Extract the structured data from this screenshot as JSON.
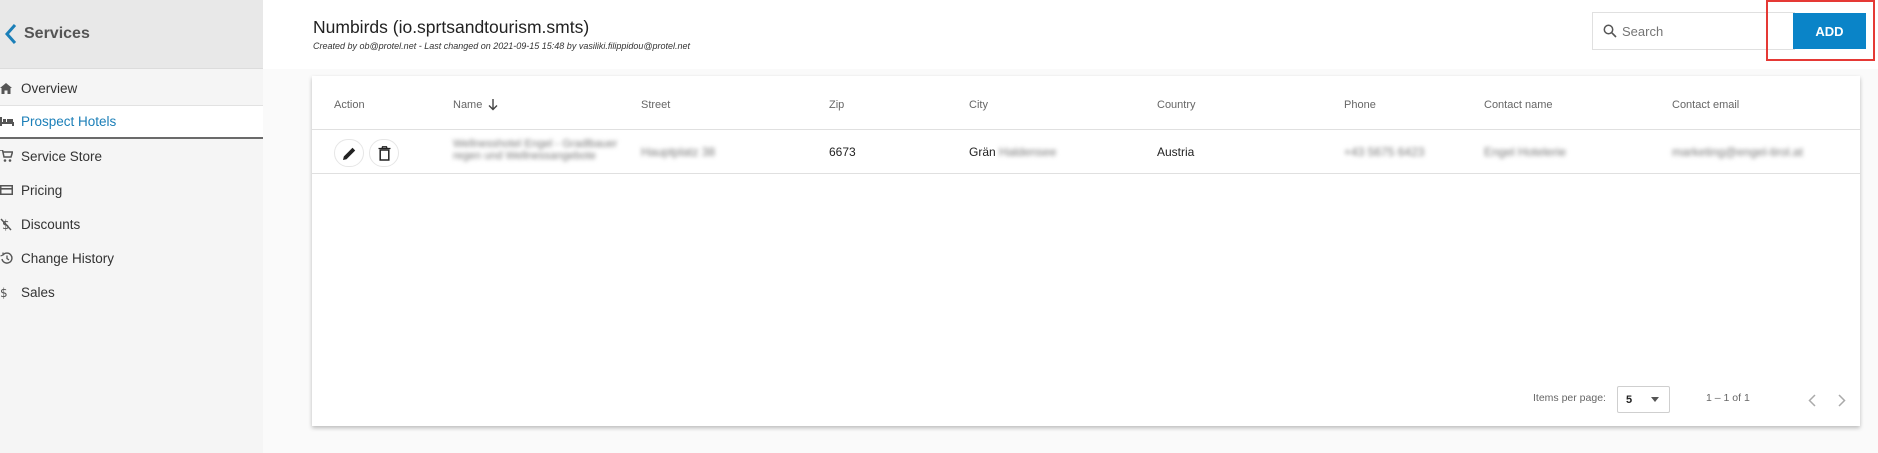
{
  "sidebar": {
    "back_label": "Services",
    "items": [
      {
        "label": "Overview",
        "icon": "home-icon",
        "active": false
      },
      {
        "label": "Prospect Hotels",
        "icon": "hotel-icon",
        "active": true
      },
      {
        "label": "Service Store",
        "icon": "cart-icon",
        "active": false
      },
      {
        "label": "Pricing",
        "icon": "card-icon",
        "active": false
      },
      {
        "label": "Discounts",
        "icon": "no-dollar-icon",
        "active": false
      },
      {
        "label": "Change History",
        "icon": "history-icon",
        "active": false
      },
      {
        "label": "Sales",
        "icon": "dollar-icon",
        "active": false
      }
    ]
  },
  "header": {
    "title": "Numbirds (io.sprtsandtourism.smts)",
    "meta": "Created by ob@protel.net - Last changed on 2021-09-15 15:48 by vasiliki.filippidou@protel.net",
    "search_placeholder": "Search",
    "add_label": "ADD"
  },
  "table": {
    "columns": [
      "Action",
      "Name",
      "Street",
      "Zip",
      "City",
      "Country",
      "Phone",
      "Contact name",
      "Contact email"
    ],
    "sorted_column": "Name",
    "rows": [
      {
        "name_line1": "Wellnesshotel Engel - Gradlbauer",
        "name_line2": "regen und Wellnessangebote",
        "street": "Hauptplatz 38",
        "zip": "6673",
        "city": "Grän",
        "city_suffix": "Haldensee",
        "country": "Austria",
        "phone": "+43 5675 6423",
        "contact_name": "Engel Hotelerie",
        "contact_email": "marketing@engel-tirol.at"
      }
    ]
  },
  "paginator": {
    "items_per_page_label": "Items per page:",
    "page_size": "5",
    "range_label": "1 – 1 of 1"
  },
  "colors": {
    "accent": "#0a84c8",
    "active_nav": "#1b7fb8",
    "highlight": "#e53935"
  }
}
